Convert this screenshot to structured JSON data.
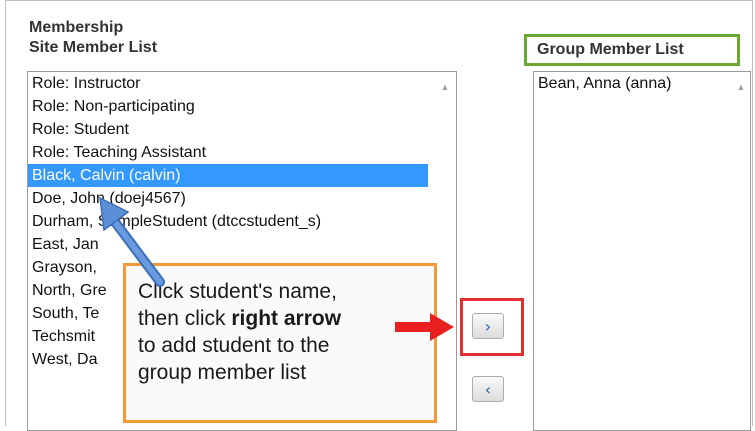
{
  "section": {
    "title": "Membership",
    "site_list_label": "Site Member List",
    "group_list_label": "Group Member List"
  },
  "site_members": [
    "Role: Instructor",
    "Role: Non-participating",
    "Role: Student",
    "Role: Teaching Assistant",
    "Black, Calvin (calvin)",
    "Doe, John (doej4567)",
    "Durham, SampleStudent (dtccstudent_s)",
    "East, Jan",
    "Grayson,",
    "North, Gre",
    "South, Te",
    "Techsmit",
    "West, Da"
  ],
  "selected_site_member": "Black, Calvin (calvin)",
  "group_members": [
    "Bean, Anna (anna)"
  ],
  "buttons": {
    "move_right": "›",
    "move_left": "‹"
  },
  "callout": {
    "line1": "Click student's name,",
    "line2_pre": "then click ",
    "line2_bold": "right arrow",
    "line3": "to add student to the",
    "line4": "group member list"
  },
  "colors": {
    "selection": "#3399ff",
    "group_heading_border": "#6aa832",
    "button_highlight": "#e03030",
    "callout_border": "#f39a37",
    "pointer_arrow": "#5b8fd6",
    "red_arrow": "#e82020"
  },
  "icons": {
    "scroll": "scroll-up-icon",
    "pointer": "pointer-arrow-icon",
    "red_arrow": "red-arrow-icon"
  }
}
